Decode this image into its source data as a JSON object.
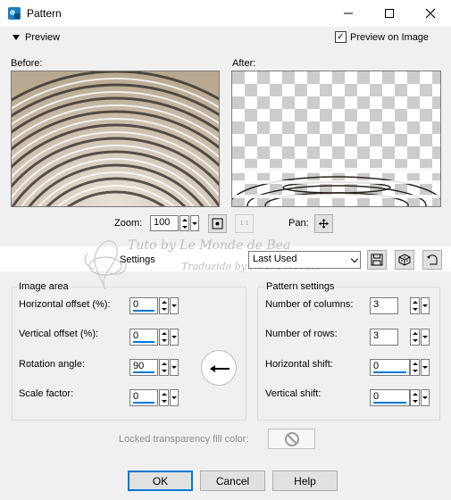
{
  "window": {
    "title": "Pattern"
  },
  "preview": {
    "label": "Preview",
    "on_image_label": "Preview on Image",
    "on_image_checked": true
  },
  "before_label": "Before:",
  "after_label": "After:",
  "zoom": {
    "label": "Zoom:",
    "value": "100"
  },
  "pan": {
    "label": "Pan:"
  },
  "watermark": {
    "line1": "Tuto by Le Monde de Bea",
    "line2": "Traduzido by Neusa Novaes"
  },
  "settings": {
    "label": "Settings",
    "selected": "Last Used"
  },
  "image_area": {
    "title": "Image area",
    "horizontal_offset_label": "Horizontal offset (%):",
    "horizontal_offset": "0",
    "vertical_offset_label": "Vertical offset (%):",
    "vertical_offset": "0",
    "rotation_angle_label": "Rotation angle:",
    "rotation_angle": "90",
    "scale_factor_label": "Scale factor:",
    "scale_factor": "0"
  },
  "pattern_settings": {
    "title": "Pattern settings",
    "columns_label": "Number of columns:",
    "columns": "3",
    "rows_label": "Number of rows:",
    "rows": "3",
    "horizontal_shift_label": "Horizontal shift:",
    "horizontal_shift": "0",
    "vertical_shift_label": "Vertical shift:",
    "vertical_shift": "0"
  },
  "locked_transparency_label": "Locked transparency fill color:",
  "buttons": {
    "ok": "OK",
    "cancel": "Cancel",
    "help": "Help"
  },
  "colors": {
    "accent": "#0078d7",
    "window_bg": "#f0f0f0"
  }
}
